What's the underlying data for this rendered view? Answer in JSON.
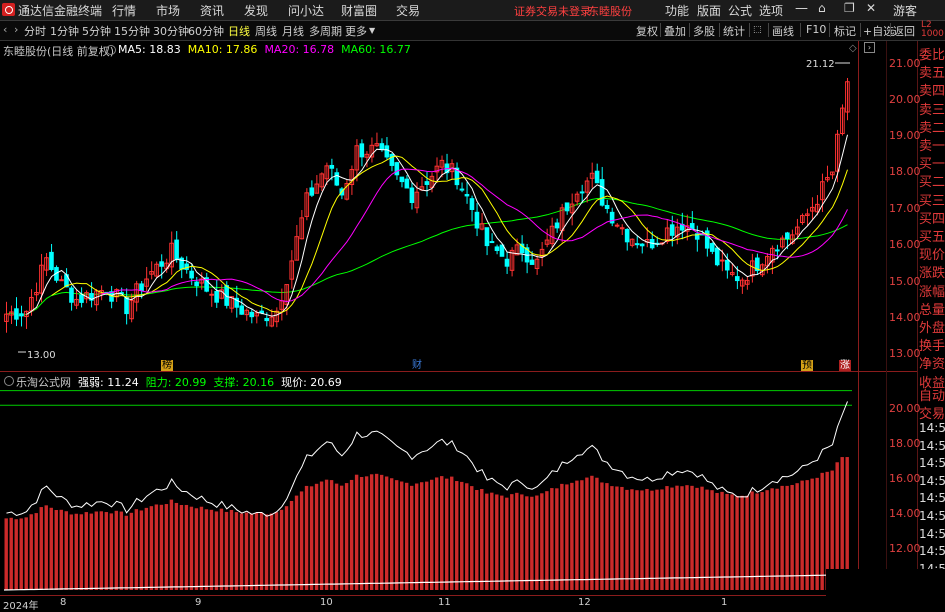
{
  "menu": {
    "app_title": "通达信金融终端",
    "items": [
      "行情",
      "市场",
      "资讯",
      "发现",
      "问小达",
      "财富圈",
      "交易"
    ],
    "notice": "证券交易未登录",
    "stock_link": "东睦股份",
    "right_items": [
      "功能",
      "版面",
      "公式",
      "选项"
    ],
    "guest": "游客"
  },
  "toolbar": {
    "periods": [
      "分时",
      "1分钟",
      "5分钟",
      "15分钟",
      "30分钟",
      "60分钟",
      "日线",
      "周线",
      "月线",
      "多周期",
      "更多"
    ],
    "active_period": "日线",
    "right_tools": [
      "复权",
      "叠加",
      "多股",
      "统计",
      "画线",
      "F10",
      "标记",
      "+自选",
      "返回"
    ]
  },
  "price_chart": {
    "stock_label": "东睦股份(日线 前复权)",
    "ma_legend": [
      {
        "text": "MA5: 18.83",
        "color": "#ffffff"
      },
      {
        "text": "MA10: 17.86",
        "color": "#ffff00"
      },
      {
        "text": "MA20: 16.78",
        "color": "#ff00ff"
      },
      {
        "text": "MA60: 16.77",
        "color": "#00ff00"
      }
    ],
    "y_ticks": [
      "21.00",
      "20.00",
      "19.00",
      "18.00",
      "17.00",
      "16.00",
      "15.00",
      "14.00",
      "13.00"
    ],
    "high_label": "21.12",
    "low_label": "13.00",
    "markers": [
      "榜",
      "财",
      "预",
      "涨"
    ]
  },
  "indicator": {
    "name": "乐淘公式网",
    "values": [
      {
        "text": "强弱: 11.24",
        "color": "#ffffff"
      },
      {
        "text": "阻力: 20.99",
        "color": "#00ff00"
      },
      {
        "text": "支撑: 20.16",
        "color": "#00ff00"
      },
      {
        "text": "现价: 20.69",
        "color": "#ffffff"
      }
    ],
    "y_ticks": [
      "20.00",
      "18.00",
      "16.00",
      "14.00",
      "12.00"
    ]
  },
  "time_axis": {
    "labels": [
      "2024年",
      "8",
      "9",
      "10",
      "11",
      "12",
      "1"
    ]
  },
  "side_panel": {
    "labels": [
      "委比",
      "卖五",
      "卖四",
      "卖三",
      "卖二",
      "卖一",
      "买一",
      "买二",
      "买三",
      "买四",
      "买五",
      "现价",
      "涨跌",
      "涨幅",
      "总量",
      "外盘",
      "换手",
      "净资",
      "收益"
    ],
    "lower_labels": [
      "自动",
      "交易"
    ],
    "times": [
      "14:56",
      "14:56",
      "14:56",
      "14:56",
      "14:56",
      "14:56",
      "14:56",
      "14:56",
      "14:56"
    ]
  },
  "colors": {
    "up": "#ff3232",
    "down": "#00ffff",
    "ma5": "#ffffff",
    "ma10": "#ffff00",
    "ma20": "#ff00ff",
    "ma60": "#00ff00",
    "border": "#8a1c1c"
  }
}
